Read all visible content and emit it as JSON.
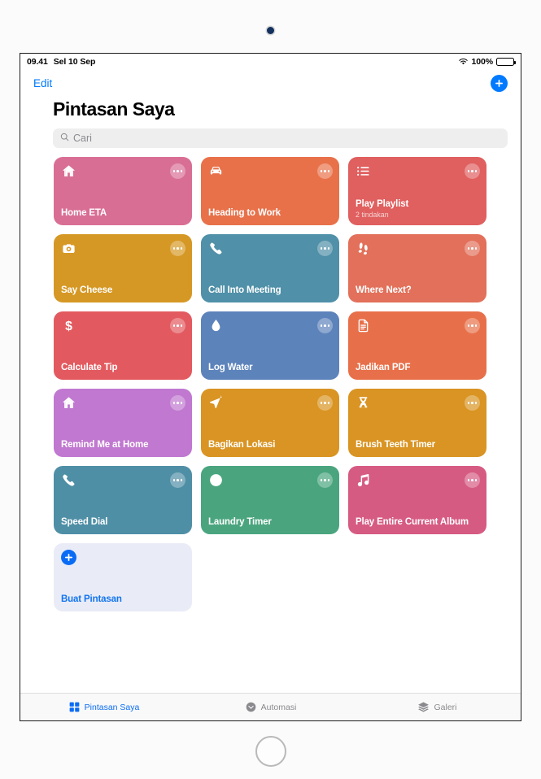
{
  "status_bar": {
    "time": "09.41",
    "date": "Sel 10 Sep",
    "battery_percent": "100%",
    "wifi_icon": "wifi-icon",
    "battery_icon": "battery-icon"
  },
  "nav": {
    "edit_label": "Edit",
    "add_icon": "plus-icon"
  },
  "header": {
    "title": "Pintasan Saya"
  },
  "search": {
    "placeholder": "Cari",
    "icon": "search-icon"
  },
  "colors": {
    "accent_blue": "#007aff",
    "create_card_bg": "#e9ecf7",
    "create_card_text": "#1274f0",
    "tab_active": "#0a6cf5",
    "tab_inactive": "#8a8a8e"
  },
  "shortcuts": [
    {
      "title": "Home ETA",
      "subtitle": "",
      "color": "#d96e94",
      "icon": "home-icon",
      "menu_icon": "ellipsis-icon"
    },
    {
      "title": "Heading to Work",
      "subtitle": "",
      "color": "#e8714a",
      "icon": "car-icon",
      "menu_icon": "ellipsis-icon"
    },
    {
      "title": "Play Playlist",
      "subtitle": "2 tindakan",
      "color": "#e05f5f",
      "icon": "list-icon",
      "menu_icon": "ellipsis-icon"
    },
    {
      "title": "Say Cheese",
      "subtitle": "",
      "color": "#d69824",
      "icon": "camera-icon",
      "menu_icon": "ellipsis-icon"
    },
    {
      "title": "Call Into Meeting",
      "subtitle": "",
      "color": "#5090a8",
      "icon": "phone-icon",
      "menu_icon": "ellipsis-icon"
    },
    {
      "title": "Where Next?",
      "subtitle": "",
      "color": "#e2705a",
      "icon": "footsteps-icon",
      "menu_icon": "ellipsis-icon"
    },
    {
      "title": "Calculate Tip",
      "subtitle": "",
      "color": "#e25a5f",
      "icon": "dollar-icon",
      "menu_icon": "ellipsis-icon"
    },
    {
      "title": "Log Water",
      "subtitle": "",
      "color": "#5d83bb",
      "icon": "droplet-icon",
      "menu_icon": "ellipsis-icon"
    },
    {
      "title": "Jadikan PDF",
      "subtitle": "",
      "color": "#e7704a",
      "icon": "document-icon",
      "menu_icon": "ellipsis-icon"
    },
    {
      "title": "Remind Me at Home",
      "subtitle": "",
      "color": "#c078d0",
      "icon": "home-icon",
      "menu_icon": "ellipsis-icon"
    },
    {
      "title": "Bagikan Lokasi",
      "subtitle": "",
      "color": "#d99423",
      "icon": "paperplane-icon",
      "menu_icon": "ellipsis-icon"
    },
    {
      "title": "Brush Teeth Timer",
      "subtitle": "",
      "color": "#d99423",
      "icon": "hourglass-icon",
      "menu_icon": "ellipsis-icon"
    },
    {
      "title": "Speed Dial",
      "subtitle": "",
      "color": "#4f8fa6",
      "icon": "phone-icon",
      "menu_icon": "ellipsis-icon"
    },
    {
      "title": "Laundry Timer",
      "subtitle": "",
      "color": "#4aa57e",
      "icon": "clock-icon",
      "menu_icon": "ellipsis-icon"
    },
    {
      "title": "Play Entire Current Album",
      "subtitle": "",
      "color": "#d65b83",
      "icon": "music-icon",
      "menu_icon": "ellipsis-icon"
    }
  ],
  "create_card": {
    "title": "Buat Pintasan",
    "icon": "plus-icon"
  },
  "tabs": [
    {
      "label": "Pintasan Saya",
      "icon": "grid-icon",
      "active": true
    },
    {
      "label": "Automasi",
      "icon": "automation-icon",
      "active": false
    },
    {
      "label": "Galeri",
      "icon": "layers-icon",
      "active": false
    }
  ]
}
